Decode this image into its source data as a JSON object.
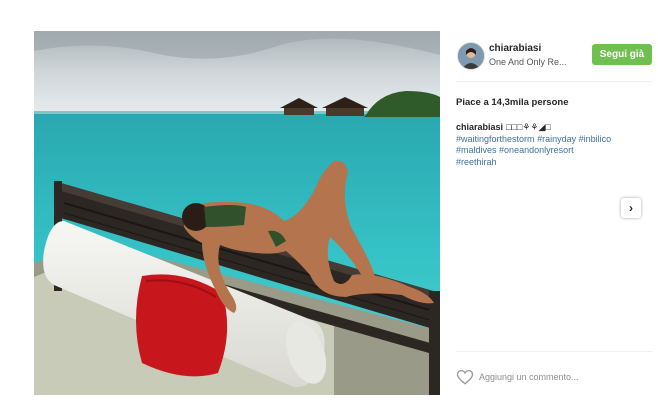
{
  "post": {
    "username": "chiarabiasi",
    "location": "One And Only Re...",
    "follow_label": "Segui già",
    "likes": "Piace a 14,3mila persone",
    "caption": {
      "user": "chiarabiasi",
      "emoji": "□□□⚘⚘◢□",
      "hashtags": [
        "#waitingforthestorm",
        "#rainyday",
        "#inbilico",
        "#maldives",
        "#oneandonlyresort",
        "#reethirah"
      ]
    },
    "comment_placeholder": "Aggiungi un commento...",
    "icons": {
      "like": "heart-outline-icon",
      "next": "chevron-right-icon"
    },
    "colors": {
      "follow_button": "#70c050",
      "hashtag": "#3f729b"
    }
  }
}
